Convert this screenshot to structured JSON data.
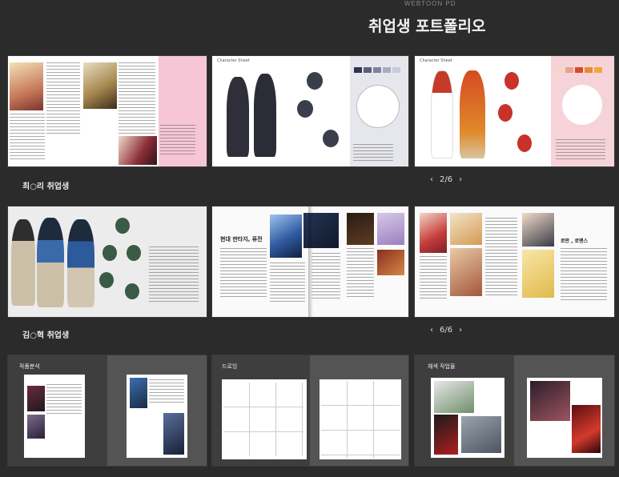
{
  "header": {
    "subtitle": "WEBTOON PD",
    "title": "취업생 포트폴리오"
  },
  "row1": {
    "cards": [
      {
        "caption": ""
      },
      {
        "caption": "Character Sheet"
      },
      {
        "caption": "Character Sheet"
      }
    ],
    "pager": {
      "prev": "‹",
      "value": "2/6",
      "next": "›"
    }
  },
  "row2": {
    "label": "최○리 취업생",
    "cards": [
      {
        "caption": "현대 판타지, 퓨전"
      },
      {
        "caption": "로판 , 로맨스"
      }
    ],
    "pager": {
      "prev": "‹",
      "value": "6/6",
      "next": "›"
    }
  },
  "row3": {
    "label": "김○혁 취업생",
    "cards": [
      {
        "title": "작품분석"
      },
      {
        "title": "드로잉"
      },
      {
        "title": "채색 작업물"
      }
    ]
  },
  "colors": {
    "bg": "#2b2b2b",
    "pink": "#f6c6d6",
    "navy": "#2f3550"
  }
}
